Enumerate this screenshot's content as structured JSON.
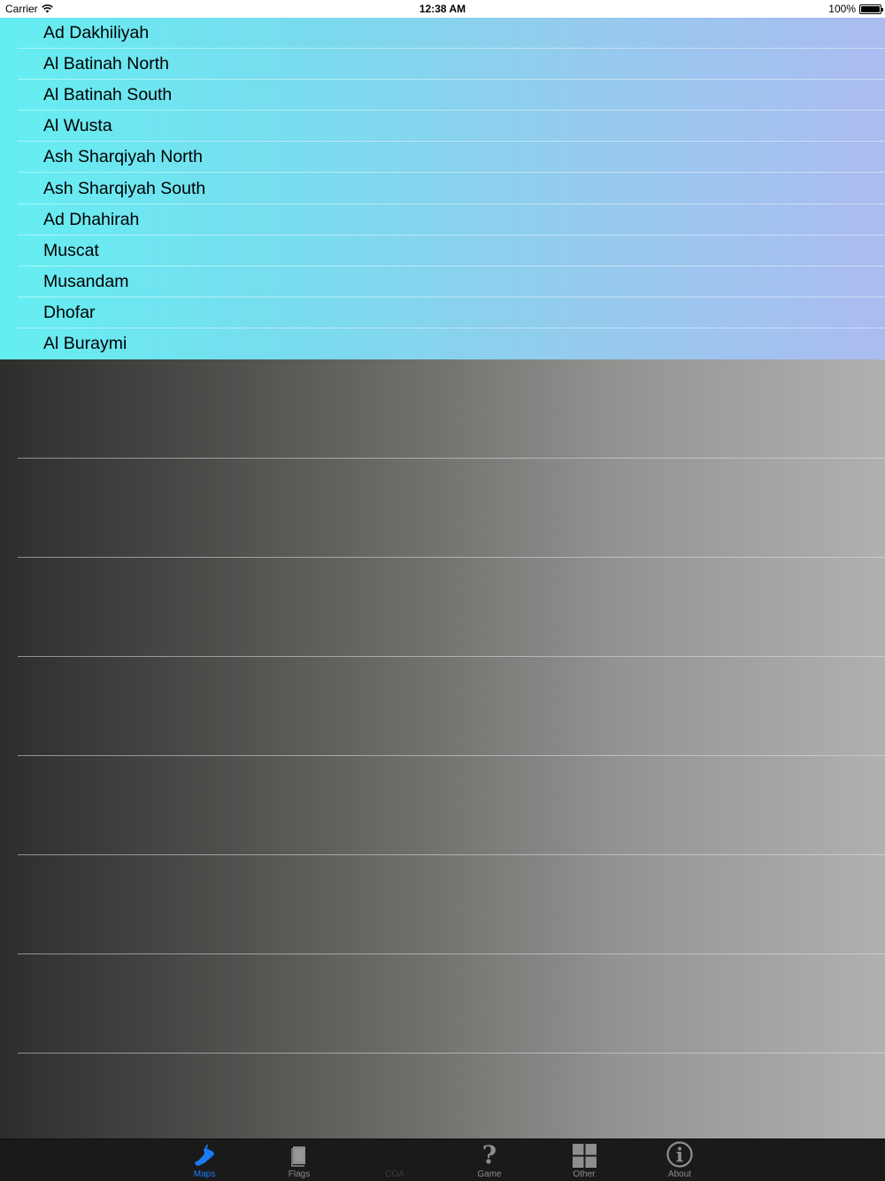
{
  "status_bar": {
    "carrier": "Carrier",
    "time": "12:38 AM",
    "battery": "100%",
    "battery_level": 1.0
  },
  "regions": [
    {
      "label": "Ad Dakhiliyah"
    },
    {
      "label": "Al Batinah North"
    },
    {
      "label": "Al Batinah South"
    },
    {
      "label": "Al Wusta"
    },
    {
      "label": "Ash Sharqiyah North"
    },
    {
      "label": "Ash Sharqiyah South"
    },
    {
      "label": "Ad Dhahirah"
    },
    {
      "label": "Muscat"
    },
    {
      "label": "Musandam"
    },
    {
      "label": "Dhofar"
    },
    {
      "label": "Al Buraymi"
    }
  ],
  "tab_bar": {
    "tabs": [
      {
        "label": "Maps",
        "icon": "oman-map-icon",
        "active": true
      },
      {
        "label": "Flags",
        "icon": "flag-book-icon",
        "active": false
      },
      {
        "label": "COA",
        "icon": "",
        "active": false
      },
      {
        "label": "Game",
        "icon": "question-mark-icon",
        "active": false
      },
      {
        "label": "Other",
        "icon": "grid-icon",
        "active": false
      },
      {
        "label": "About",
        "icon": "info-icon",
        "active": false
      }
    ],
    "active_color": "#1a7cf5",
    "inactive_color": "#8e8e8e"
  }
}
